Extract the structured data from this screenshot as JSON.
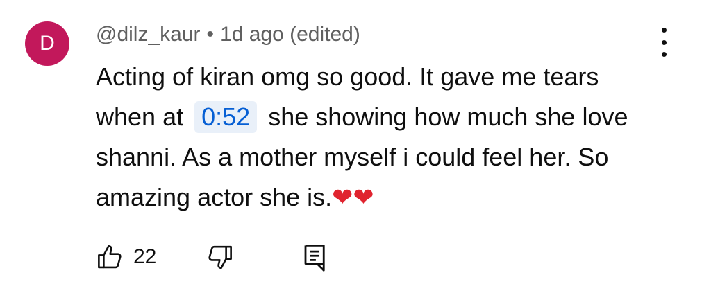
{
  "avatar": {
    "letter": "D",
    "color": "#c2185b"
  },
  "author": {
    "handle": "@dilz_kaur",
    "separator": "•",
    "time": "1d ago (edited)"
  },
  "comment": {
    "text_1": "Acting of kiran omg so good. It gave me tears when at",
    "timestamp": "0:52",
    "text_2": "she showing how much she love shanni. As a mother myself i could feel her. So amazing actor she is.",
    "emoji": "❤❤"
  },
  "actions": {
    "like_count": "22",
    "like_icon": "thumbs-up-icon",
    "dislike_icon": "thumbs-down-icon",
    "reply_icon": "reply-icon"
  },
  "menu_icon": "more-vertical-icon",
  "colors": {
    "timestamp_bg": "#e9f0f9",
    "timestamp_text": "#065fd4",
    "heart": "#e0242f",
    "meta": "#606060"
  }
}
